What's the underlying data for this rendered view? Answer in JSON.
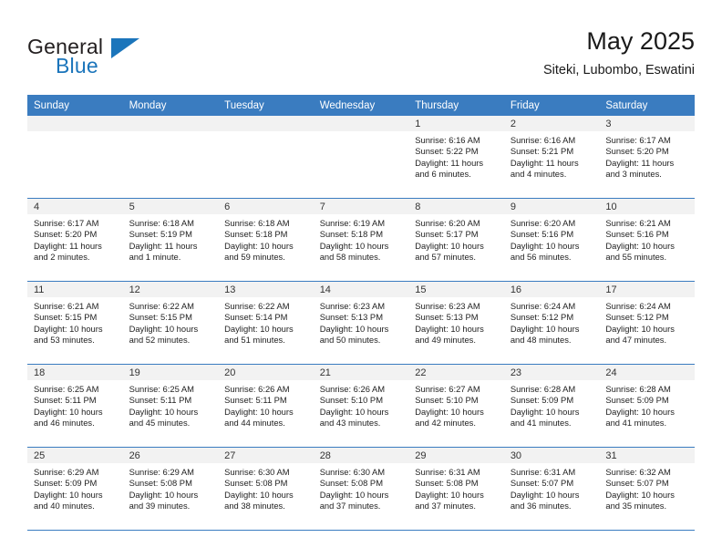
{
  "brand": {
    "name_part1": "General",
    "name_part2": "Blue",
    "logo_icon": "triangle-flag-icon"
  },
  "header": {
    "title": "May 2025",
    "location": "Siteki, Lubombo, Eswatini"
  },
  "colors": {
    "header_blue": "#3a7cc0",
    "brand_blue": "#1b75bb",
    "daynum_band": "#f2f2f2",
    "text": "#222222"
  },
  "weekdays": [
    "Sunday",
    "Monday",
    "Tuesday",
    "Wednesday",
    "Thursday",
    "Friday",
    "Saturday"
  ],
  "labels": {
    "sunrise": "Sunrise:",
    "sunset": "Sunset:",
    "daylight": "Daylight:"
  },
  "weeks": [
    [
      {
        "day": "",
        "empty": true
      },
      {
        "day": "",
        "empty": true
      },
      {
        "day": "",
        "empty": true
      },
      {
        "day": "",
        "empty": true
      },
      {
        "day": "1",
        "sunrise": "Sunrise: 6:16 AM",
        "sunset": "Sunset: 5:22 PM",
        "daylight_line1": "Daylight: 11 hours",
        "daylight_line2": "and 6 minutes."
      },
      {
        "day": "2",
        "sunrise": "Sunrise: 6:16 AM",
        "sunset": "Sunset: 5:21 PM",
        "daylight_line1": "Daylight: 11 hours",
        "daylight_line2": "and 4 minutes."
      },
      {
        "day": "3",
        "sunrise": "Sunrise: 6:17 AM",
        "sunset": "Sunset: 5:20 PM",
        "daylight_line1": "Daylight: 11 hours",
        "daylight_line2": "and 3 minutes."
      }
    ],
    [
      {
        "day": "4",
        "sunrise": "Sunrise: 6:17 AM",
        "sunset": "Sunset: 5:20 PM",
        "daylight_line1": "Daylight: 11 hours",
        "daylight_line2": "and 2 minutes."
      },
      {
        "day": "5",
        "sunrise": "Sunrise: 6:18 AM",
        "sunset": "Sunset: 5:19 PM",
        "daylight_line1": "Daylight: 11 hours",
        "daylight_line2": "and 1 minute."
      },
      {
        "day": "6",
        "sunrise": "Sunrise: 6:18 AM",
        "sunset": "Sunset: 5:18 PM",
        "daylight_line1": "Daylight: 10 hours",
        "daylight_line2": "and 59 minutes."
      },
      {
        "day": "7",
        "sunrise": "Sunrise: 6:19 AM",
        "sunset": "Sunset: 5:18 PM",
        "daylight_line1": "Daylight: 10 hours",
        "daylight_line2": "and 58 minutes."
      },
      {
        "day": "8",
        "sunrise": "Sunrise: 6:20 AM",
        "sunset": "Sunset: 5:17 PM",
        "daylight_line1": "Daylight: 10 hours",
        "daylight_line2": "and 57 minutes."
      },
      {
        "day": "9",
        "sunrise": "Sunrise: 6:20 AM",
        "sunset": "Sunset: 5:16 PM",
        "daylight_line1": "Daylight: 10 hours",
        "daylight_line2": "and 56 minutes."
      },
      {
        "day": "10",
        "sunrise": "Sunrise: 6:21 AM",
        "sunset": "Sunset: 5:16 PM",
        "daylight_line1": "Daylight: 10 hours",
        "daylight_line2": "and 55 minutes."
      }
    ],
    [
      {
        "day": "11",
        "sunrise": "Sunrise: 6:21 AM",
        "sunset": "Sunset: 5:15 PM",
        "daylight_line1": "Daylight: 10 hours",
        "daylight_line2": "and 53 minutes."
      },
      {
        "day": "12",
        "sunrise": "Sunrise: 6:22 AM",
        "sunset": "Sunset: 5:15 PM",
        "daylight_line1": "Daylight: 10 hours",
        "daylight_line2": "and 52 minutes."
      },
      {
        "day": "13",
        "sunrise": "Sunrise: 6:22 AM",
        "sunset": "Sunset: 5:14 PM",
        "daylight_line1": "Daylight: 10 hours",
        "daylight_line2": "and 51 minutes."
      },
      {
        "day": "14",
        "sunrise": "Sunrise: 6:23 AM",
        "sunset": "Sunset: 5:13 PM",
        "daylight_line1": "Daylight: 10 hours",
        "daylight_line2": "and 50 minutes."
      },
      {
        "day": "15",
        "sunrise": "Sunrise: 6:23 AM",
        "sunset": "Sunset: 5:13 PM",
        "daylight_line1": "Daylight: 10 hours",
        "daylight_line2": "and 49 minutes."
      },
      {
        "day": "16",
        "sunrise": "Sunrise: 6:24 AM",
        "sunset": "Sunset: 5:12 PM",
        "daylight_line1": "Daylight: 10 hours",
        "daylight_line2": "and 48 minutes."
      },
      {
        "day": "17",
        "sunrise": "Sunrise: 6:24 AM",
        "sunset": "Sunset: 5:12 PM",
        "daylight_line1": "Daylight: 10 hours",
        "daylight_line2": "and 47 minutes."
      }
    ],
    [
      {
        "day": "18",
        "sunrise": "Sunrise: 6:25 AM",
        "sunset": "Sunset: 5:11 PM",
        "daylight_line1": "Daylight: 10 hours",
        "daylight_line2": "and 46 minutes."
      },
      {
        "day": "19",
        "sunrise": "Sunrise: 6:25 AM",
        "sunset": "Sunset: 5:11 PM",
        "daylight_line1": "Daylight: 10 hours",
        "daylight_line2": "and 45 minutes."
      },
      {
        "day": "20",
        "sunrise": "Sunrise: 6:26 AM",
        "sunset": "Sunset: 5:11 PM",
        "daylight_line1": "Daylight: 10 hours",
        "daylight_line2": "and 44 minutes."
      },
      {
        "day": "21",
        "sunrise": "Sunrise: 6:26 AM",
        "sunset": "Sunset: 5:10 PM",
        "daylight_line1": "Daylight: 10 hours",
        "daylight_line2": "and 43 minutes."
      },
      {
        "day": "22",
        "sunrise": "Sunrise: 6:27 AM",
        "sunset": "Sunset: 5:10 PM",
        "daylight_line1": "Daylight: 10 hours",
        "daylight_line2": "and 42 minutes."
      },
      {
        "day": "23",
        "sunrise": "Sunrise: 6:28 AM",
        "sunset": "Sunset: 5:09 PM",
        "daylight_line1": "Daylight: 10 hours",
        "daylight_line2": "and 41 minutes."
      },
      {
        "day": "24",
        "sunrise": "Sunrise: 6:28 AM",
        "sunset": "Sunset: 5:09 PM",
        "daylight_line1": "Daylight: 10 hours",
        "daylight_line2": "and 41 minutes."
      }
    ],
    [
      {
        "day": "25",
        "sunrise": "Sunrise: 6:29 AM",
        "sunset": "Sunset: 5:09 PM",
        "daylight_line1": "Daylight: 10 hours",
        "daylight_line2": "and 40 minutes."
      },
      {
        "day": "26",
        "sunrise": "Sunrise: 6:29 AM",
        "sunset": "Sunset: 5:08 PM",
        "daylight_line1": "Daylight: 10 hours",
        "daylight_line2": "and 39 minutes."
      },
      {
        "day": "27",
        "sunrise": "Sunrise: 6:30 AM",
        "sunset": "Sunset: 5:08 PM",
        "daylight_line1": "Daylight: 10 hours",
        "daylight_line2": "and 38 minutes."
      },
      {
        "day": "28",
        "sunrise": "Sunrise: 6:30 AM",
        "sunset": "Sunset: 5:08 PM",
        "daylight_line1": "Daylight: 10 hours",
        "daylight_line2": "and 37 minutes."
      },
      {
        "day": "29",
        "sunrise": "Sunrise: 6:31 AM",
        "sunset": "Sunset: 5:08 PM",
        "daylight_line1": "Daylight: 10 hours",
        "daylight_line2": "and 37 minutes."
      },
      {
        "day": "30",
        "sunrise": "Sunrise: 6:31 AM",
        "sunset": "Sunset: 5:07 PM",
        "daylight_line1": "Daylight: 10 hours",
        "daylight_line2": "and 36 minutes."
      },
      {
        "day": "31",
        "sunrise": "Sunrise: 6:32 AM",
        "sunset": "Sunset: 5:07 PM",
        "daylight_line1": "Daylight: 10 hours",
        "daylight_line2": "and 35 minutes."
      }
    ]
  ]
}
